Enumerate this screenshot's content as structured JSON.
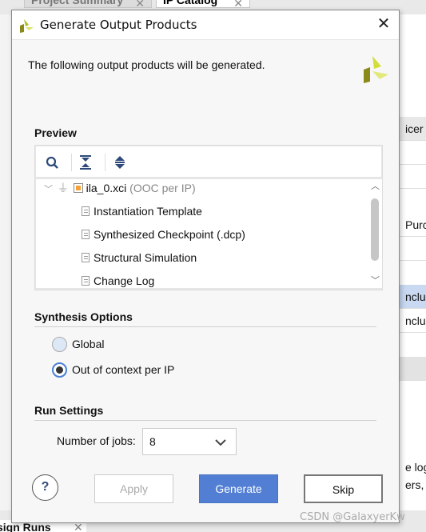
{
  "background": {
    "tabs": [
      {
        "label": "Project Summary"
      },
      {
        "label": "IP Catalog"
      }
    ],
    "bottom_tab": "sign Runs",
    "right_fragments": [
      "icer",
      "Purc",
      "nclu",
      "nclu",
      "e log",
      "ers,"
    ]
  },
  "dialog": {
    "title": "Generate Output Products",
    "intro": "The following output products will be generated.",
    "preview": {
      "heading": "Preview",
      "toolbar": [
        "search-icon",
        "collapse-all-icon",
        "expand-all-icon"
      ],
      "root": {
        "name": "ila_0.xci",
        "mode": "(OOC per IP)"
      },
      "children": [
        "Instantiation Template",
        "Synthesized Checkpoint (.dcp)",
        "Structural Simulation",
        "Change Log"
      ]
    },
    "synthesis": {
      "heading": "Synthesis Options",
      "options": [
        {
          "label": "Global",
          "selected": false
        },
        {
          "label": "Out of context per IP",
          "selected": true
        }
      ]
    },
    "run": {
      "heading": "Run Settings",
      "jobs_label": "Number of jobs:",
      "jobs_value": "8"
    },
    "buttons": {
      "help": "?",
      "apply": "Apply",
      "generate": "Generate",
      "skip": "Skip"
    },
    "colors": {
      "primary": "#527fd3",
      "logo_light": "#d4de3a",
      "logo_dark": "#8a8a1a"
    }
  },
  "watermark": "CSDN @GalaxyerKw"
}
